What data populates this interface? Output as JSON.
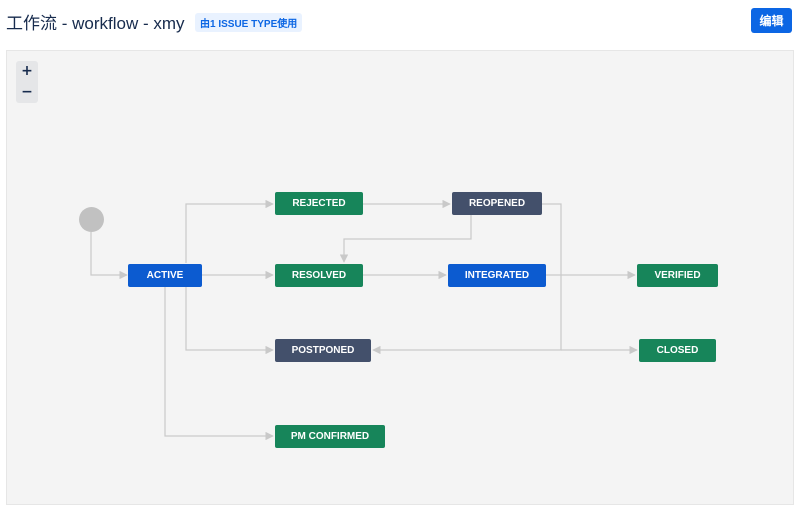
{
  "header": {
    "title": "工作流 - workflow - xmy",
    "issue_type_badge": "由1 ISSUE TYPE使用",
    "edit_label": "编辑"
  },
  "zoom": {
    "in_label": "+",
    "out_label": "−"
  },
  "colors": {
    "blue": "#0c5bd0",
    "green": "#17855a",
    "gray": "#43506b",
    "edge": "#c9c9c9"
  },
  "workflow": {
    "statuses": {
      "active": "ACTIVE",
      "rejected": "REJECTED",
      "reopened": "REOPENED",
      "resolved": "RESOLVED",
      "integrated": "INTEGRATED",
      "verified": "VERIFIED",
      "postponed": "POSTPONED",
      "closed": "CLOSED",
      "pm_confirmed": "PM CONFIRMED"
    }
  }
}
